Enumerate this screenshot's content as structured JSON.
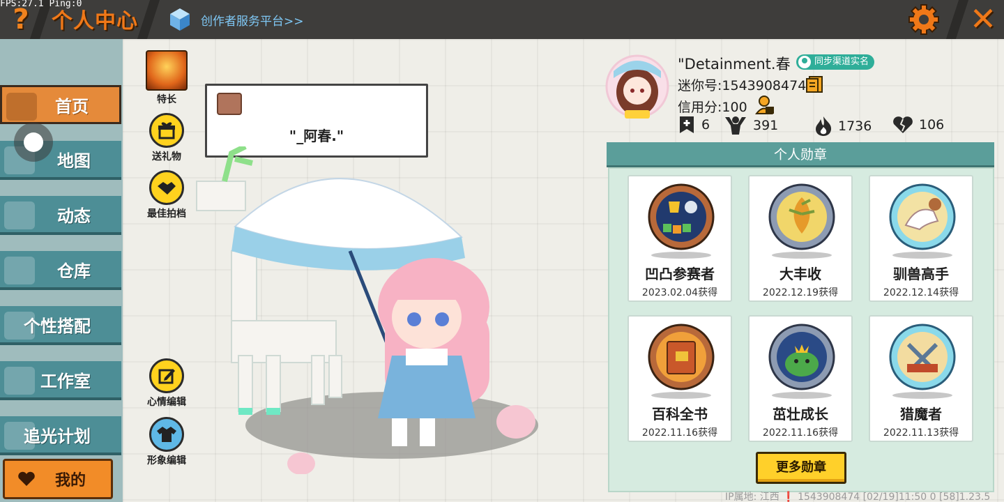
{
  "debug": {
    "fps": "FPS:27.1  Ping:0"
  },
  "topbar": {
    "help_glyph": "?",
    "title": "个人中心",
    "creator_link": "创作者服务平台>>",
    "close_glyph": "✕"
  },
  "sidebar": {
    "items": [
      {
        "label": "首页",
        "active": true
      },
      {
        "label": "地图",
        "active": false
      },
      {
        "label": "动态",
        "active": false
      },
      {
        "label": "仓库",
        "active": false
      },
      {
        "label": "个性搭配",
        "active": false
      },
      {
        "label": "工作室",
        "active": false
      },
      {
        "label": "追光计划",
        "active": false
      }
    ],
    "mine_label": "我的"
  },
  "actions": {
    "talent": "特长",
    "gift": "送礼物",
    "best_shot": "最佳拍档",
    "mood_edit": "心情编辑",
    "look_edit": "形象编辑"
  },
  "speech": {
    "text": "\"_阿春.\""
  },
  "profile": {
    "nickname": "\"Detainment.春",
    "sync_badge": "同步渠道实名",
    "mini_id": "迷你号:1543908474",
    "credit": "信用分:100",
    "stats": {
      "badges": "6",
      "followers": "391",
      "heat": "1736",
      "likes": "106"
    }
  },
  "medals": {
    "header": "个人勋章",
    "items": [
      {
        "name": "凹凸参赛者",
        "date": "2023.02.04获得",
        "frame": "bronze"
      },
      {
        "name": "大丰收",
        "date": "2022.12.19获得",
        "frame": "silver"
      },
      {
        "name": "驯兽高手",
        "date": "2022.12.14获得",
        "frame": "blue"
      },
      {
        "name": "百科全书",
        "date": "2022.11.16获得",
        "frame": "bronze"
      },
      {
        "name": "茁壮成长",
        "date": "2022.11.16获得",
        "frame": "silver"
      },
      {
        "name": "猎魔者",
        "date": "2022.11.13获得",
        "frame": "blue"
      }
    ],
    "more_button": "更多勋章"
  },
  "footer": {
    "info": "IP属地: 江西 ❗      1543908474   [02/19]11:50 0  [58]1.23.5"
  },
  "colors": {
    "accent_orange": "#f07818",
    "sidebar_teal": "#4d8e96",
    "medal_header": "#5b9e9a",
    "more_button": "#ffd02a"
  }
}
